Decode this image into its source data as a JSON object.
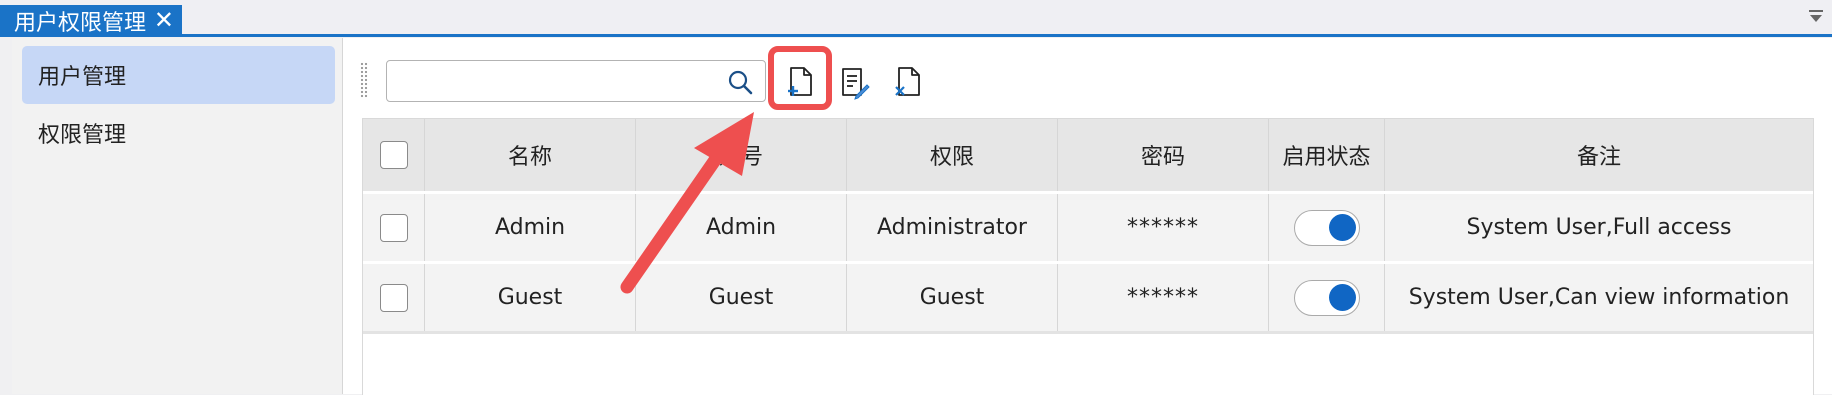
{
  "tab": {
    "title": "用户权限管理",
    "close_glyph": "✕"
  },
  "sidebar": {
    "items": [
      {
        "label": "用户管理",
        "active": true
      },
      {
        "label": "权限管理",
        "active": false
      }
    ]
  },
  "search": {
    "value": "",
    "placeholder": ""
  },
  "toolbar": {
    "buttons": [
      "add-document-icon",
      "edit-document-icon",
      "delete-document-icon"
    ]
  },
  "table": {
    "headers": [
      "",
      "名称",
      "账号",
      "权限",
      "密码",
      "启用状态",
      "备注"
    ],
    "rows": [
      {
        "checked": false,
        "name": "Admin",
        "account": "Admin",
        "permission": "Administrator",
        "password": "******",
        "enabled": true,
        "note": "System User,Full access"
      },
      {
        "checked": false,
        "name": "Guest",
        "account": "Guest",
        "permission": "Guest",
        "password": "******",
        "enabled": true,
        "note": "System User,Can view information"
      }
    ]
  },
  "colors": {
    "accent": "#1a73c7",
    "sidebar_active": "#c6d7f6",
    "annotation": "#ee4f4f",
    "toggle_on": "#1066c4"
  }
}
